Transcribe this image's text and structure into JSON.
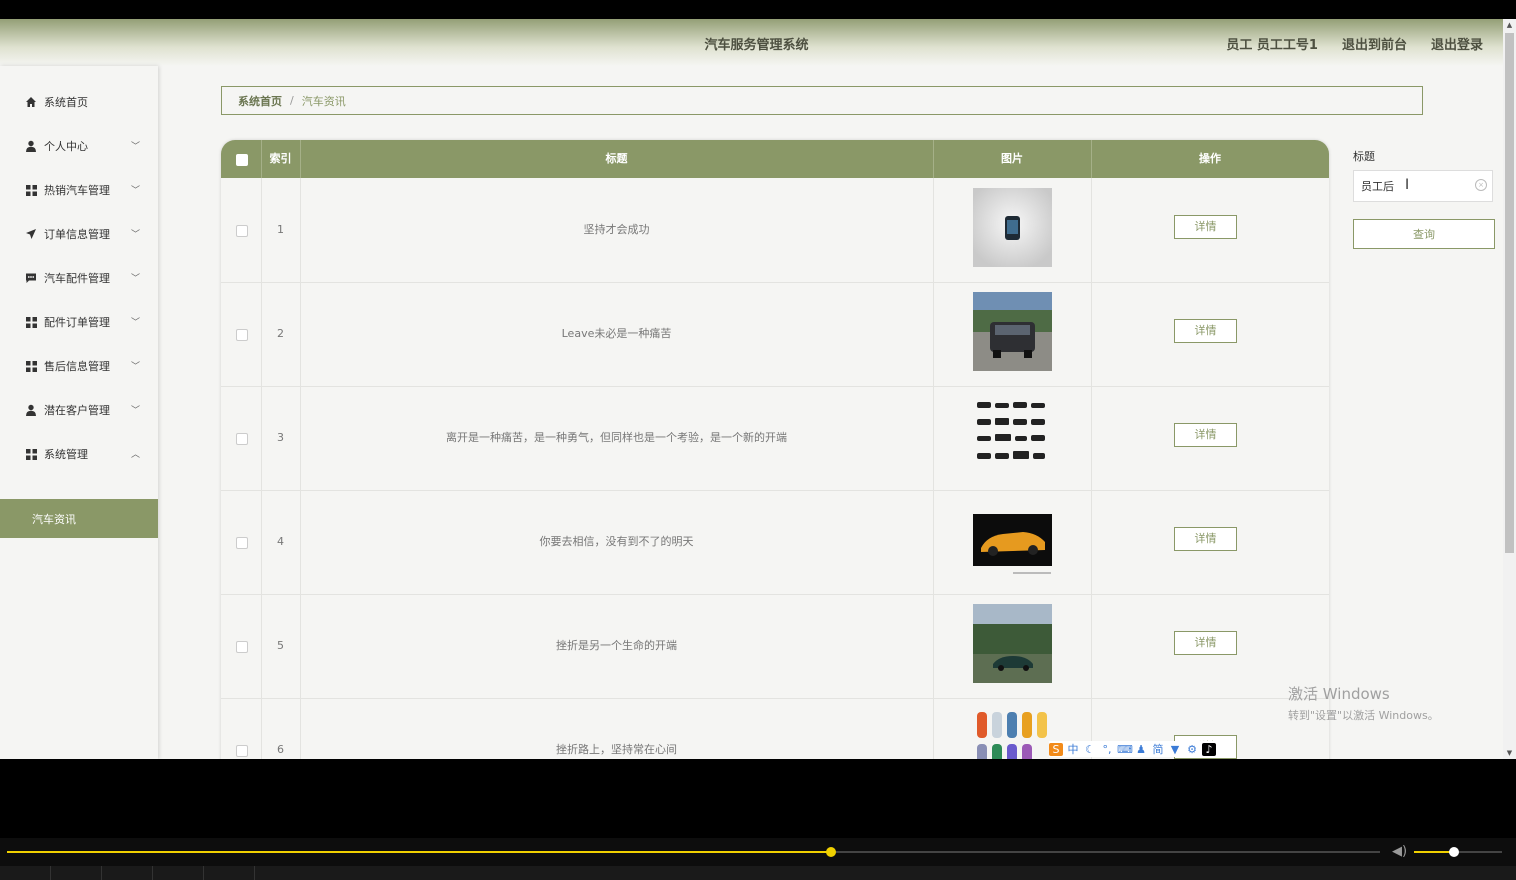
{
  "header": {
    "app_title": "汽车服务管理系统",
    "user_label": "员工 员工工号1",
    "back_to_front": "退出到前台",
    "logout": "退出登录"
  },
  "sidebar": {
    "items": [
      {
        "label": "系统首页",
        "icon": "home-icon"
      },
      {
        "label": "个人中心",
        "icon": "user-icon"
      },
      {
        "label": "热销汽车管理",
        "icon": "grid-icon"
      },
      {
        "label": "订单信息管理",
        "icon": "paper-plane-icon"
      },
      {
        "label": "汽车配件管理",
        "icon": "chat-icon"
      },
      {
        "label": "配件订单管理",
        "icon": "grid-icon"
      },
      {
        "label": "售后信息管理",
        "icon": "grid-icon"
      },
      {
        "label": "潜在客户管理",
        "icon": "user-icon"
      },
      {
        "label": "系统管理",
        "icon": "grid-icon"
      }
    ],
    "active_sub": "汽车资讯"
  },
  "breadcrumb": {
    "home": "系统首页",
    "separator": "/",
    "current": "汽车资讯"
  },
  "table": {
    "headers": {
      "index": "索引",
      "title": "标题",
      "image": "图片",
      "action": "操作"
    },
    "detail_label": "详情",
    "rows": [
      {
        "index": "1",
        "title": "坚持才会成功",
        "image": "phone-thumbnail"
      },
      {
        "index": "2",
        "title": "Leave未必是一种痛苦",
        "image": "suv-photo"
      },
      {
        "index": "3",
        "title": "离开是一种痛苦，是一种勇气，但同样也是一个考验，是一个新的开端",
        "image": "vehicle-icons-grid"
      },
      {
        "index": "4",
        "title": "你要去相信，没有到不了的明天",
        "image": "orange-sports-car"
      },
      {
        "index": "5",
        "title": "挫折是另一个生命的开端",
        "image": "green-car-landscape"
      },
      {
        "index": "6",
        "title": "挫折路上，坚持常在心间",
        "image": "colorful-cars-topview"
      }
    ]
  },
  "search": {
    "label": "标题",
    "value": "员工后",
    "button": "查询"
  },
  "watermark": {
    "line1": "激活 Windows",
    "line2": "转到\"设置\"以激活 Windows。"
  },
  "ime": [
    "中",
    "简"
  ],
  "player": {
    "progress": 0.6,
    "volume": 0.45
  },
  "colors": {
    "accent": "#8a9867",
    "header_text": "#4d5040"
  }
}
